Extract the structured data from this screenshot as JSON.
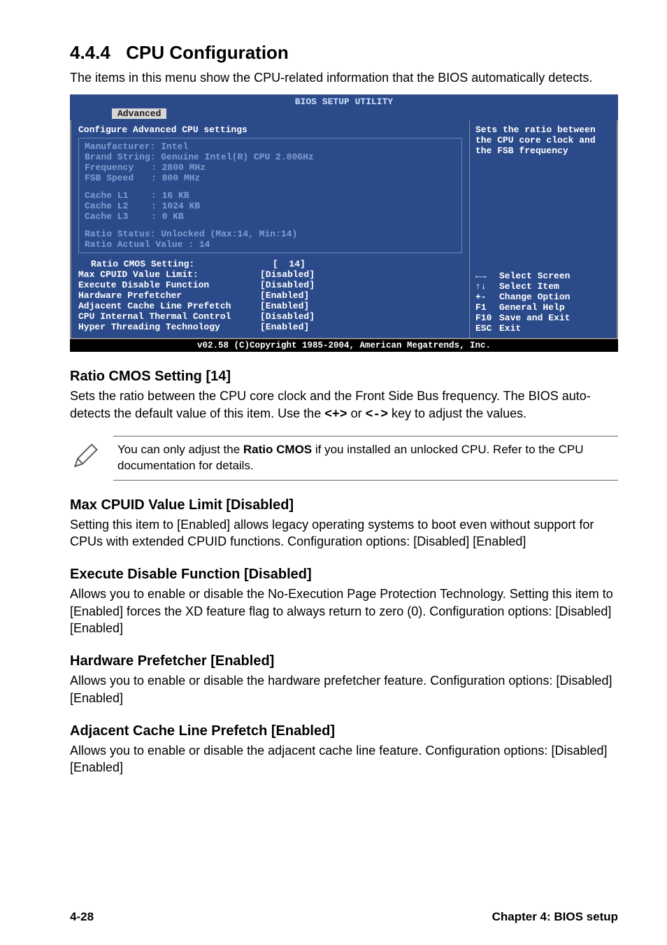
{
  "heading": {
    "num": "4.4.4",
    "title": "CPU Configuration"
  },
  "intro": "The items in this menu show the CPU-related information that the BIOS automatically detects.",
  "bios": {
    "title": "BIOS SETUP UTILITY",
    "tab": "Advanced",
    "left": {
      "header": "Configure Advanced CPU settings",
      "info": {
        "manufacturer_label": "Manufacturer:",
        "manufacturer": "Intel",
        "brand_label": "Brand String:",
        "brand": "Genuine Intel(R) CPU 2.80GHz",
        "freq_label": "Frequency",
        "freq": "2800 MHz",
        "fsb_label": "FSB Speed",
        "fsb": "800 MHz",
        "l1_label": "Cache L1",
        "l1": "16 KB",
        "l2_label": "Cache L2",
        "l2": "1024 KB",
        "l3_label": "Cache L3",
        "l3": "0 KB",
        "ratio_status": "Ratio Status: Unlocked (Max:14, Min:14)",
        "ratio_actual": "Ratio Actual Value : 14"
      },
      "settings": [
        {
          "label": "Ratio CMOS Setting:",
          "value": "[  14]",
          "indent": true
        },
        {
          "label": "Max CPUID Value Limit:",
          "value": "[Disabled]"
        },
        {
          "label": "Execute Disable Function",
          "value": "[Disabled]"
        },
        {
          "label": "Hardware Prefetcher",
          "value": "[Enabled]"
        },
        {
          "label": "Adjacent Cache Line Prefetch",
          "value": "[Enabled]"
        },
        {
          "label": "CPU Internal Thermal Control",
          "value": "[Disabled]"
        },
        {
          "label": "Hyper Threading Technology",
          "value": "[Enabled]"
        }
      ]
    },
    "right": {
      "help": "Sets the ratio between the CPU core clock and the FSB frequency",
      "keys": [
        {
          "k": "←→",
          "d": "Select Screen"
        },
        {
          "k": "↑↓",
          "d": "Select Item"
        },
        {
          "k": "+-",
          "d": "Change Option"
        },
        {
          "k": "F1",
          "d": "General Help"
        },
        {
          "k": "F10",
          "d": "Save and Exit"
        },
        {
          "k": "ESC",
          "d": "Exit"
        }
      ]
    },
    "footer": "v02.58 (C)Copyright 1985-2004, American Megatrends, Inc."
  },
  "ratio_cmos": {
    "head": "Ratio CMOS Setting [14]",
    "body_a": "Sets the ratio between the CPU core clock and the Front Side Bus frequency. The BIOS auto-detects the default value of this item. Use the ",
    "kplus": "<+>",
    "or": " or ",
    "kminus": "<->",
    "body_b": " key to adjust the values."
  },
  "note": {
    "pre": "You can only adjust the ",
    "bold": "Ratio CMOS",
    "post": " if you installed an unlocked CPU. Refer to the CPU documentation for details."
  },
  "max_cpuid": {
    "head": "Max CPUID Value Limit [Disabled]",
    "body": "Setting this item to [Enabled] allows legacy operating systems to boot even without support for CPUs with extended CPUID functions. Configuration options: [Disabled] [Enabled]"
  },
  "exec_disable": {
    "head": "Execute Disable Function [Disabled]",
    "body": "Allows you to enable or disable the No-Execution Page Protection Technology. Setting this item to [Enabled] forces the XD feature flag to always return to zero (0). Configuration options: [Disabled] [Enabled]"
  },
  "hw_prefetch": {
    "head": "Hardware Prefetcher [Enabled]",
    "body": "Allows you to enable or disable the hardware prefetcher feature. Configuration options: [Disabled] [Enabled]"
  },
  "adj_cache": {
    "head": "Adjacent Cache Line Prefetch [Enabled]",
    "body": "Allows you to enable or disable the adjacent cache line feature. Configuration options: [Disabled] [Enabled]"
  },
  "footer": {
    "page": "4-28",
    "chapter": "Chapter 4: BIOS setup"
  }
}
